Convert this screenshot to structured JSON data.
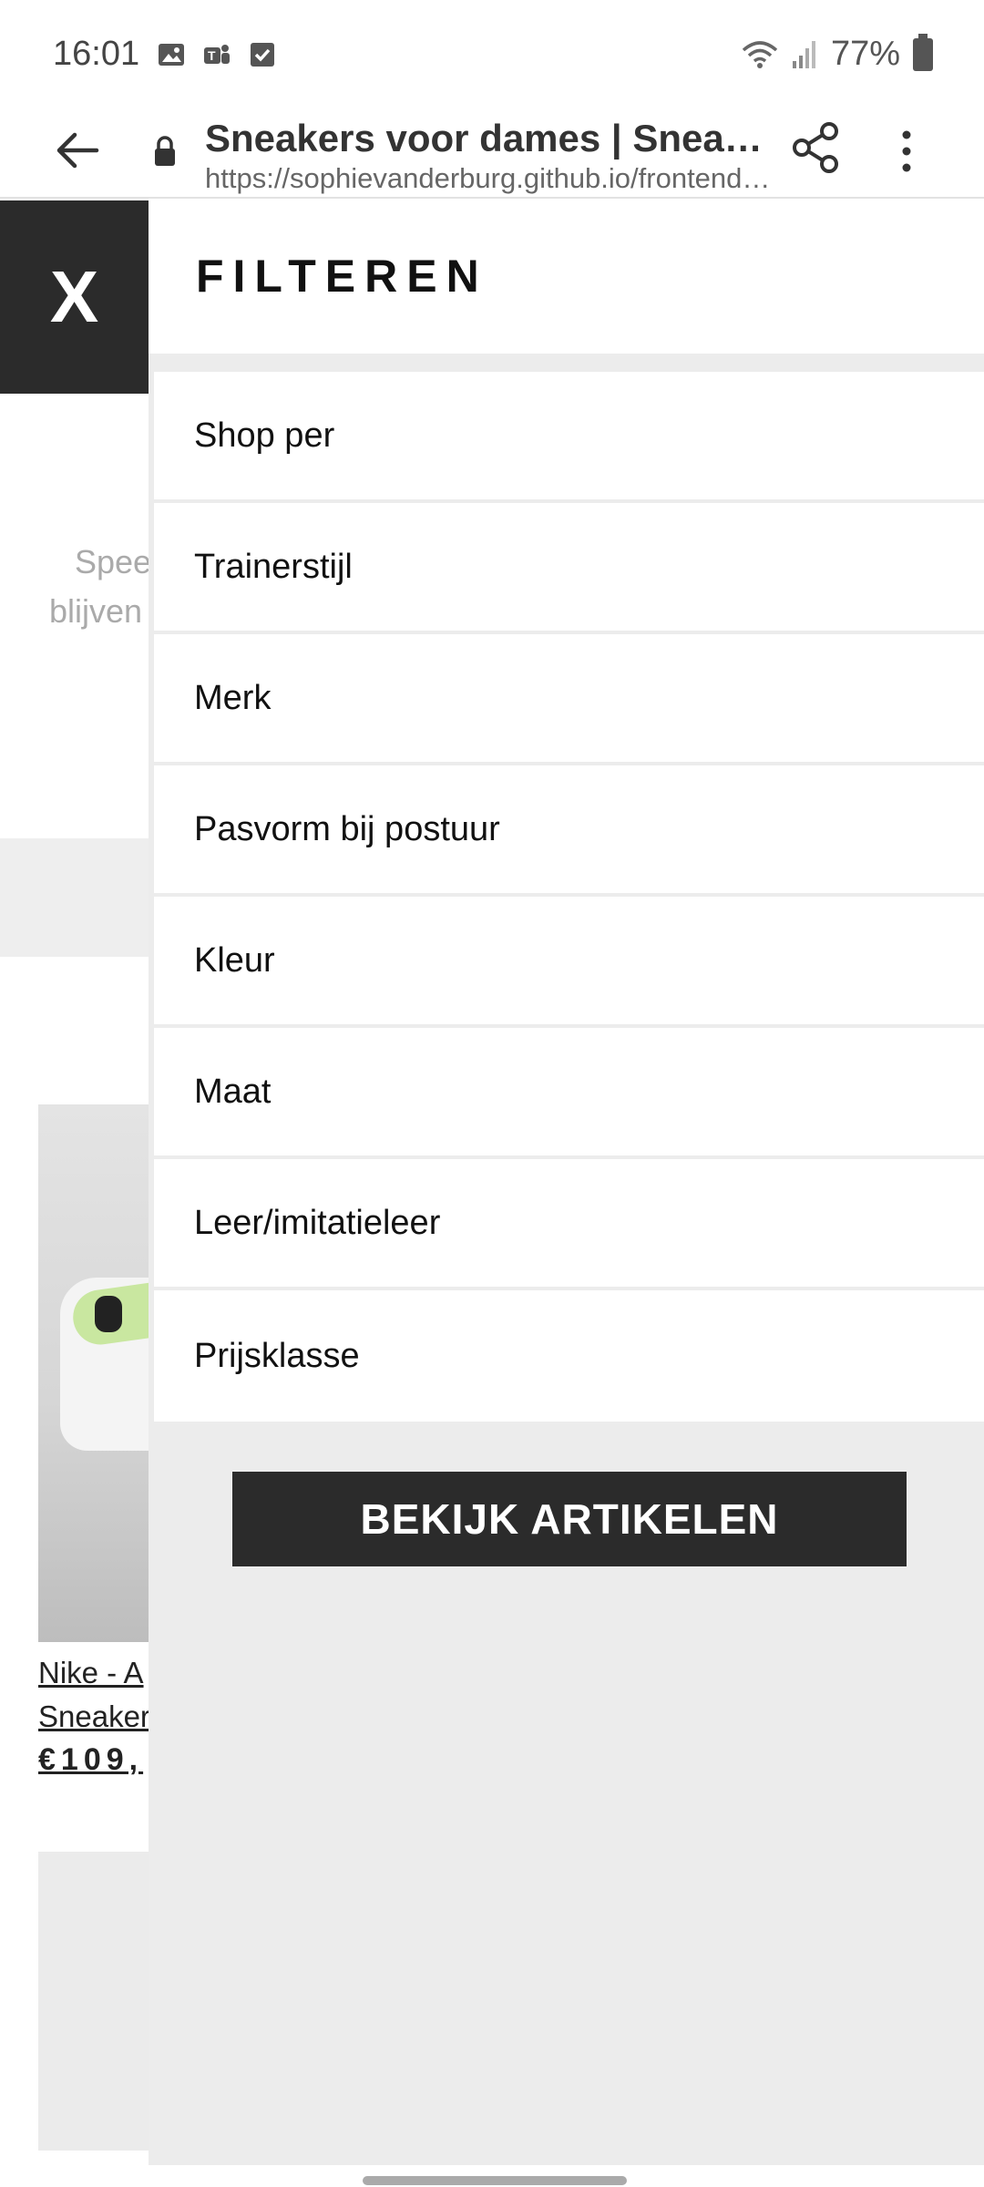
{
  "status_bar": {
    "time": "16:01",
    "battery": "77%",
    "icons": [
      "image-icon",
      "teams-icon",
      "checkbox-icon",
      "wifi-icon",
      "signal-icon",
      "battery-icon"
    ]
  },
  "browser": {
    "title": "Sneakers voor dames | Sneakers…",
    "url": "https://sophievanderburg.github.io/frontend_…"
  },
  "background_page": {
    "intro_text_line1": "Spee",
    "intro_text_line2": "blijven",
    "product_name_line1": "Nike - A",
    "product_name_line2": "Sneakers",
    "product_price": "€109,"
  },
  "filter": {
    "close_label": "X",
    "title": "FILTEREN",
    "items": [
      {
        "label": "Shop per"
      },
      {
        "label": "Trainerstijl"
      },
      {
        "label": "Merk"
      },
      {
        "label": "Pasvorm bij postuur"
      },
      {
        "label": "Kleur"
      },
      {
        "label": "Maat"
      },
      {
        "label": "Leer/imitatieleer"
      },
      {
        "label": "Prijsklasse"
      }
    ],
    "apply_label": "BEKIJK ARTIKELEN"
  },
  "colors": {
    "dark": "#2b2b2b",
    "panel_bg": "#ececec",
    "shoe_accent": "#c9e7a0"
  }
}
